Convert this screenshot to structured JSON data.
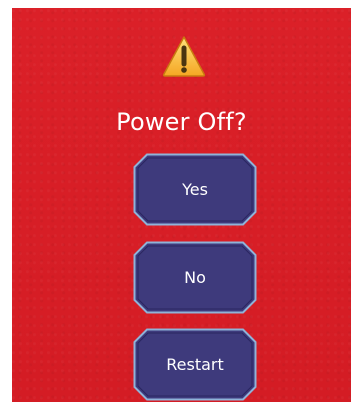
{
  "dialog": {
    "icon": "warning-icon",
    "title": "Power Off?",
    "background_color": "#d81f26",
    "buttons": [
      {
        "id": "yes",
        "label": "Yes"
      },
      {
        "id": "no",
        "label": "No"
      },
      {
        "id": "restart",
        "label": "Restart"
      }
    ],
    "button_fill": "#3e3a7c",
    "button_border": "#8fb3d8"
  }
}
